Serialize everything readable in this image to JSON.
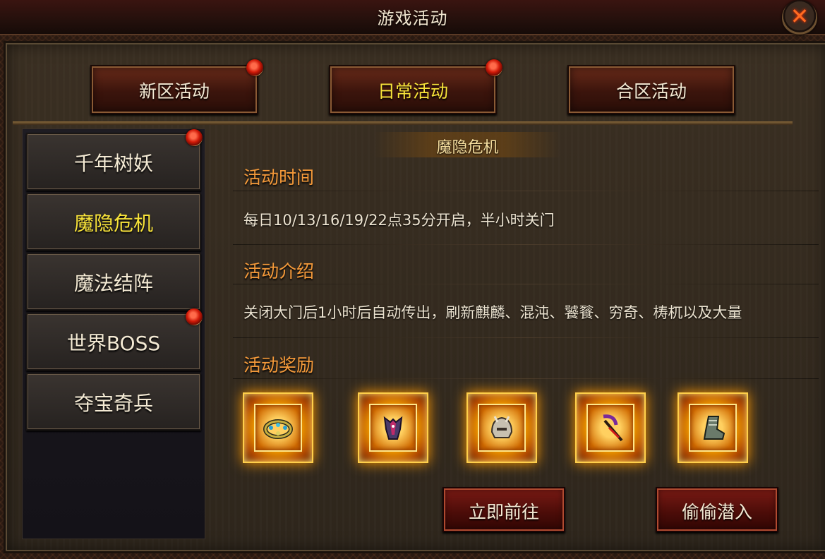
{
  "window": {
    "title": "游戏活动",
    "close_icon": "close-icon"
  },
  "tabs": [
    {
      "label": "新区活动",
      "badge": true
    },
    {
      "label": "日常活动",
      "badge": true,
      "active": true
    },
    {
      "label": "合区活动",
      "badge": false
    }
  ],
  "sidebar": {
    "items": [
      {
        "label": "千年树妖",
        "badge": true
      },
      {
        "label": "魔隐危机",
        "badge": false,
        "active": true
      },
      {
        "label": "魔法结阵",
        "badge": false
      },
      {
        "label": "世界BOSS",
        "badge": true
      },
      {
        "label": "夺宝奇兵",
        "badge": false
      }
    ]
  },
  "content": {
    "title": "魔隐危机",
    "time_heading": "活动时间",
    "time_text": "每日10/13/16/19/22点35分开启，半小时关门",
    "intro_heading": "活动介绍",
    "intro_text": "关闭大门后1小时后自动传出，刷新麒麟、混沌、饕餮、穷奇、梼杌以及大量",
    "reward_heading": "活动奖励",
    "rewards": [
      {
        "icon": "jeweled-ring-icon"
      },
      {
        "icon": "purple-armor-icon"
      },
      {
        "icon": "helmet-icon"
      },
      {
        "icon": "scythe-weapon-icon"
      },
      {
        "icon": "boots-icon"
      }
    ]
  },
  "actions": {
    "go_now": "立即前往",
    "sneak_in": "偷偷潜入"
  },
  "colors": {
    "accent_orange": "#f59a3a",
    "active_yellow": "#f8e33a",
    "badge_red": "#d01a08"
  }
}
